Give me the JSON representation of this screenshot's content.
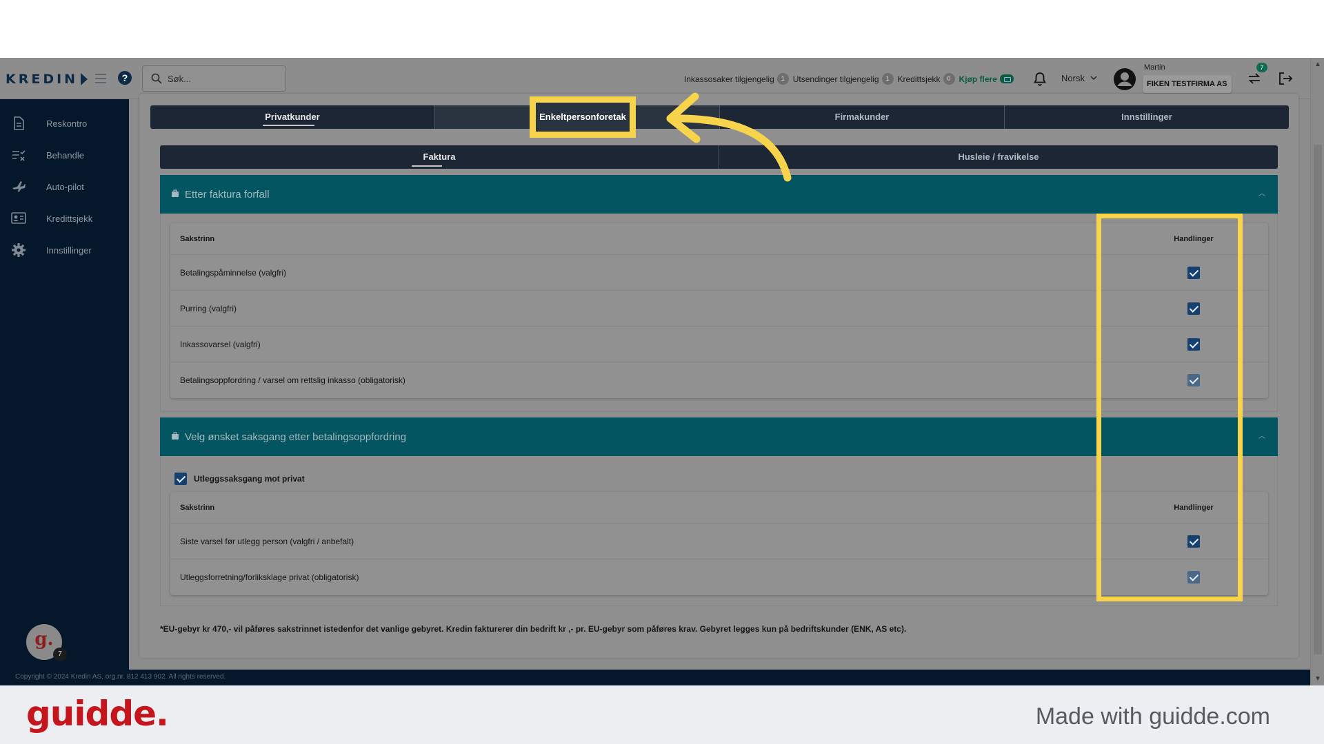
{
  "header": {
    "logo": "KREDIN",
    "search_placeholder": "Søk...",
    "stats": [
      {
        "label": "Inkassosaker tilgjengelig",
        "count": "1"
      },
      {
        "label": "Utsendinger tilgjengelig",
        "count": "1"
      },
      {
        "label": "Kredittsjekk",
        "count": "0"
      }
    ],
    "buy_more": "Kjøp flere",
    "language": "Norsk",
    "user_name": "Martin",
    "company": "FIKEN TESTFIRMA AS",
    "switch_badge": "7"
  },
  "sidebar": {
    "items": [
      {
        "label": "Reskontro",
        "icon": "document-icon"
      },
      {
        "label": "Behandle",
        "icon": "checklist-icon"
      },
      {
        "label": "Auto-pilot",
        "icon": "airplane-icon"
      },
      {
        "label": "Kredittsjekk",
        "icon": "id-card-icon"
      },
      {
        "label": "Innstillinger",
        "icon": "gear-icon"
      }
    ],
    "avatar_letter": "g.",
    "avatar_badge": "7"
  },
  "tabs_top": [
    "Privatkunder",
    "Enkeltpersonforetak",
    "Firmakunder",
    "Innstillinger"
  ],
  "tabs_sub": [
    "Faktura",
    "Husleie / fravikelse"
  ],
  "section1": {
    "title": "Etter faktura forfall",
    "col_step": "Sakstrinn",
    "col_actions": "Handlinger",
    "rows": [
      {
        "label": "Betalingspåminnelse (valgfri)",
        "checked": true,
        "disabled": false
      },
      {
        "label": "Purring (valgfri)",
        "checked": true,
        "disabled": false
      },
      {
        "label": "Inkassovarsel (valgfri)",
        "checked": true,
        "disabled": false
      },
      {
        "label": "Betalingsoppfordring / varsel om rettslig inkasso (obligatorisk)",
        "checked": true,
        "disabled": true
      }
    ]
  },
  "section2": {
    "title": "Velg ønsket saksgang etter betalingsoppfordring",
    "checkbox_label": "Utleggssaksgang mot privat",
    "col_step": "Sakstrinn",
    "col_actions": "Handlinger",
    "rows": [
      {
        "label": "Siste varsel før utlegg person (valgfri / anbefalt)",
        "checked": true,
        "disabled": false
      },
      {
        "label": "Utleggsforretning/forliksklage privat (obligatorisk)",
        "checked": true,
        "disabled": true
      }
    ]
  },
  "note": "*EU-gebyr kr 470,- vil påføres sakstrinnet istedenfor det vanlige gebyret. Kredin fakturerer din bedrift kr ,- pr. EU-gebyr som påføres krav. Gebyret legges kun på bedriftskunder (ENK, AS etc).",
  "footer": "Copyright © 2024 Kredin AS, org.nr. 812 413 902. All rights reserved.",
  "brand": {
    "logo": "guidde.",
    "made_with": "Made with guidde.com"
  },
  "colors": {
    "highlight": "#f7d44c",
    "section_header": "#025561",
    "sidebar": "#05182b",
    "brand_red": "#c4161c"
  }
}
